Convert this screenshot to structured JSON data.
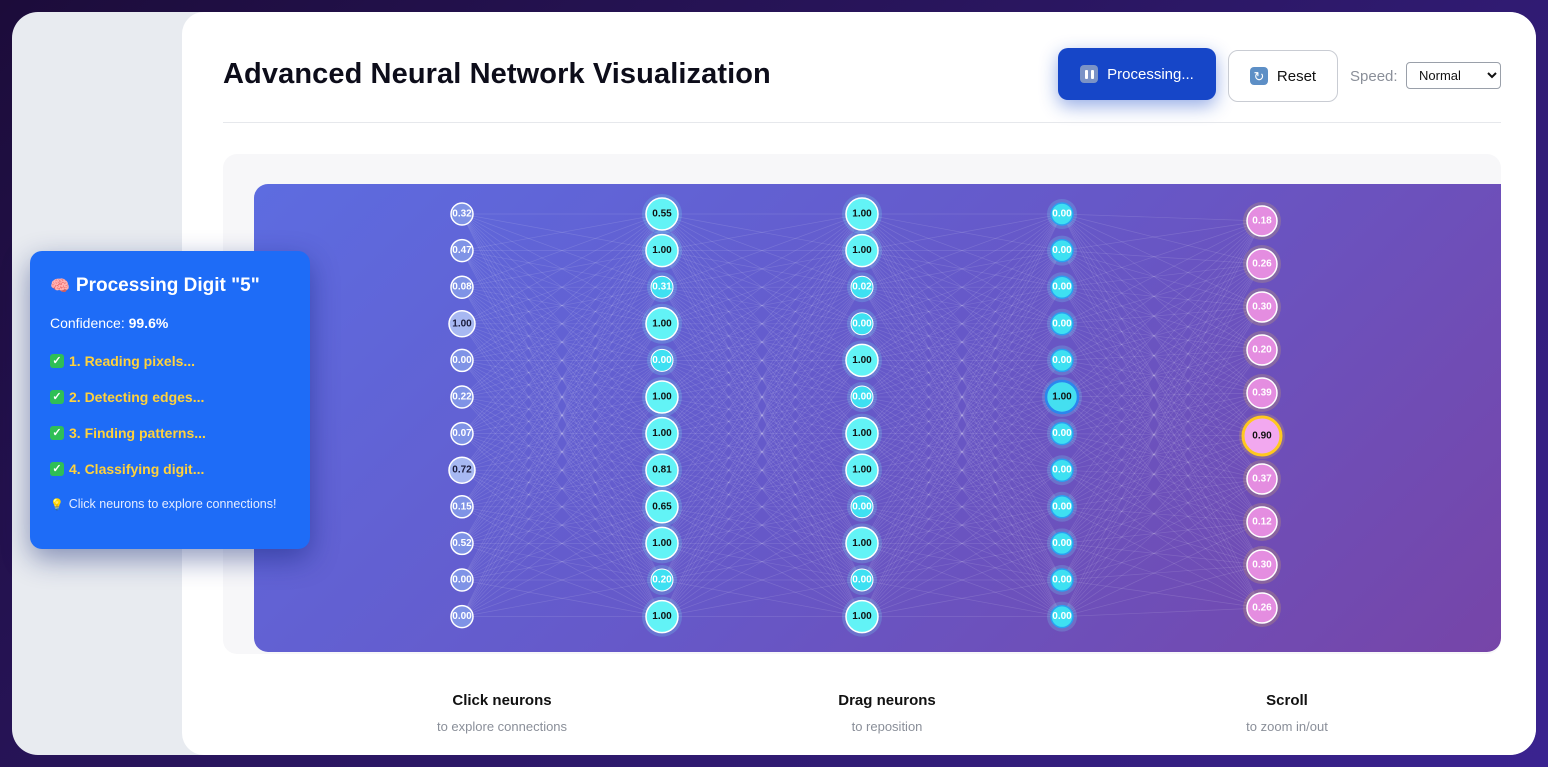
{
  "header": {
    "title": "Advanced Neural Network Visualization",
    "pause_button": {
      "label": "Processing...",
      "icon": "pause-icon"
    },
    "reset_button": {
      "label": "Reset",
      "icon": "reset-icon"
    },
    "speed": {
      "label": "Speed:",
      "selected": "Normal"
    }
  },
  "info_card": {
    "title": "Processing Digit \"5\"",
    "title_icon": "brain-icon",
    "confidence_label": "Confidence:",
    "confidence_value": "99.6%",
    "steps": [
      "1. Reading pixels...",
      "2. Detecting edges...",
      "3. Finding patterns...",
      "4. Classifying digit..."
    ],
    "tip": "Click neurons to explore connections!"
  },
  "network": {
    "layers": [
      {
        "values": [
          "0.32",
          "0.47",
          "0.08",
          "1.00",
          "0.00",
          "0.22",
          "0.07",
          "0.72",
          "0.15",
          "0.52",
          "0.00",
          "0.00"
        ]
      },
      {
        "values": [
          "0.55",
          "1.00",
          "0.31",
          "1.00",
          "0.00",
          "1.00",
          "1.00",
          "0.81",
          "0.65",
          "1.00",
          "0.20",
          "1.00"
        ]
      },
      {
        "values": [
          "1.00",
          "1.00",
          "0.02",
          "0.00",
          "1.00",
          "0.00",
          "1.00",
          "1.00",
          "0.00",
          "1.00",
          "0.00",
          "1.00"
        ]
      },
      {
        "values": [
          "0.00",
          "0.00",
          "0.00",
          "0.00",
          "0.00",
          "1.00",
          "0.00",
          "0.00",
          "0.00",
          "0.00",
          "0.00",
          "0.00"
        ]
      },
      {
        "values": [
          "0.18",
          "0.26",
          "0.30",
          "0.20",
          "0.39",
          "0.90",
          "0.37",
          "0.12",
          "0.30",
          "0.26"
        ]
      }
    ],
    "highlighted_output": 5
  },
  "hints": [
    {
      "title": "Click neurons",
      "subtitle": "to explore connections"
    },
    {
      "title": "Drag neurons",
      "subtitle": "to reposition"
    },
    {
      "title": "Scroll",
      "subtitle": "to zoom in/out"
    }
  ]
}
